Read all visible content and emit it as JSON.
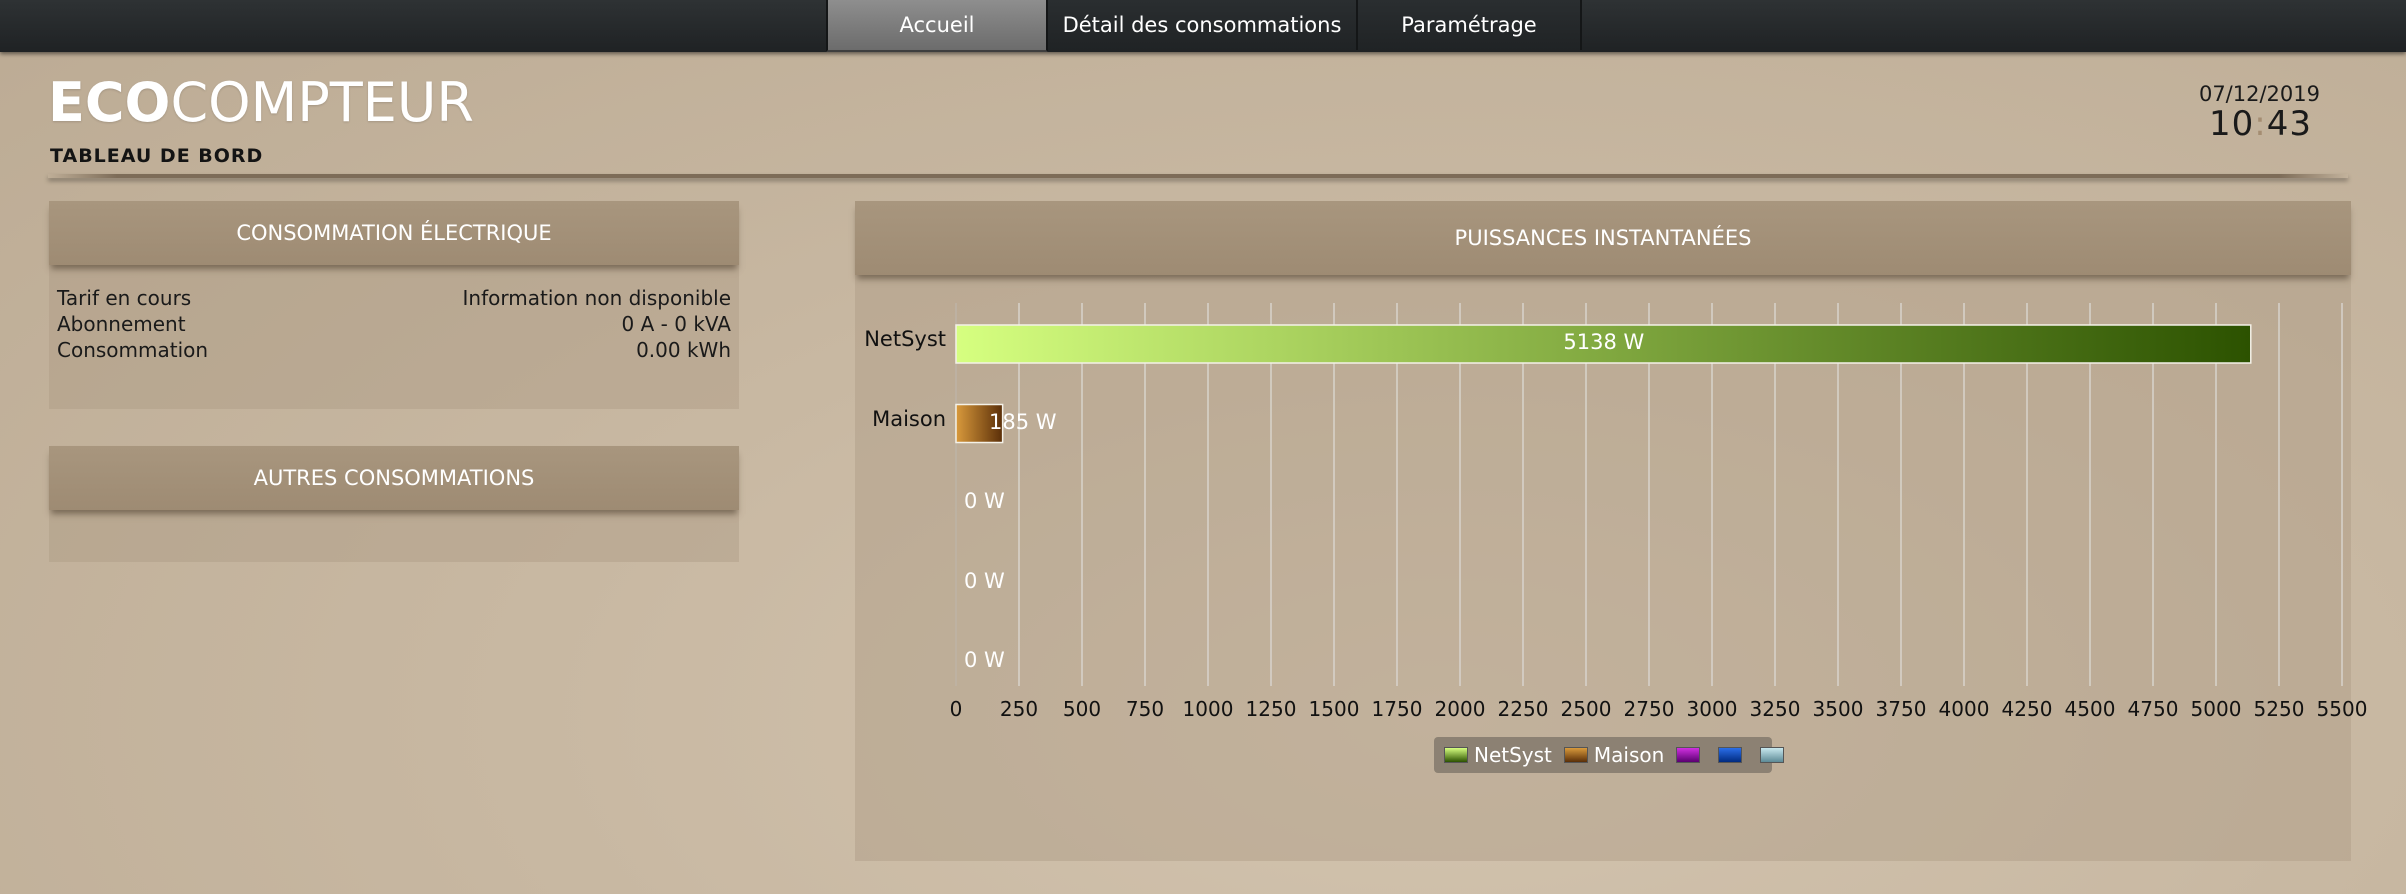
{
  "nav": {
    "tabs": [
      {
        "label": "Accueil",
        "active": true
      },
      {
        "label": "Détail des consommations",
        "active": false
      },
      {
        "label": "Paramétrage",
        "active": false
      }
    ]
  },
  "header": {
    "logo_bold": "ECO",
    "logo_rest": "COMPTEUR",
    "subtitle": "TABLEAU DE BORD",
    "date": "07/12/2019",
    "time_hours": "10",
    "time_sep": ":",
    "time_minutes": "43"
  },
  "consommation": {
    "title": "CONSOMMATION ÉLECTRIQUE",
    "rows": [
      {
        "label": "Tarif en cours",
        "value": "Information non disponible"
      },
      {
        "label": "Abonnement",
        "value": "0 A - 0 kVA"
      },
      {
        "label": "Consommation",
        "value": "0.00 kWh"
      }
    ]
  },
  "autres": {
    "title": "AUTRES CONSOMMATIONS"
  },
  "puissances": {
    "title": "PUISSANCES INSTANTANÉES"
  },
  "chart_data": {
    "type": "bar",
    "orientation": "horizontal",
    "categories": [
      "NetSyst",
      "Maison",
      "",
      "",
      ""
    ],
    "values": [
      5138,
      185,
      0,
      0,
      0
    ],
    "value_labels": [
      "5138 W",
      "185 W",
      "0 W",
      "0 W",
      "0 W"
    ],
    "xlim": [
      0,
      5500
    ],
    "ticks": [
      "0",
      "250",
      "500",
      "750",
      "1000",
      "1250",
      "1500",
      "1750",
      "2000",
      "2250",
      "2500",
      "2750",
      "3000",
      "3250",
      "3500",
      "3750",
      "4000",
      "4250",
      "4500",
      "4750",
      "5000",
      "5250",
      "5500"
    ],
    "grid": true,
    "colors": [
      [
        "#d6ff80",
        "#2c5200"
      ],
      [
        "#d99a3c",
        "#5a2e08"
      ],
      [
        "#d030e0",
        "#5a0070"
      ],
      [
        "#2a6ee8",
        "#002b80"
      ],
      [
        "#c8e8ee",
        "#5d8a96"
      ]
    ],
    "legend": {
      "position": "bottom-center",
      "entries": [
        "NetSyst",
        "Maison",
        "",
        "",
        ""
      ]
    }
  }
}
